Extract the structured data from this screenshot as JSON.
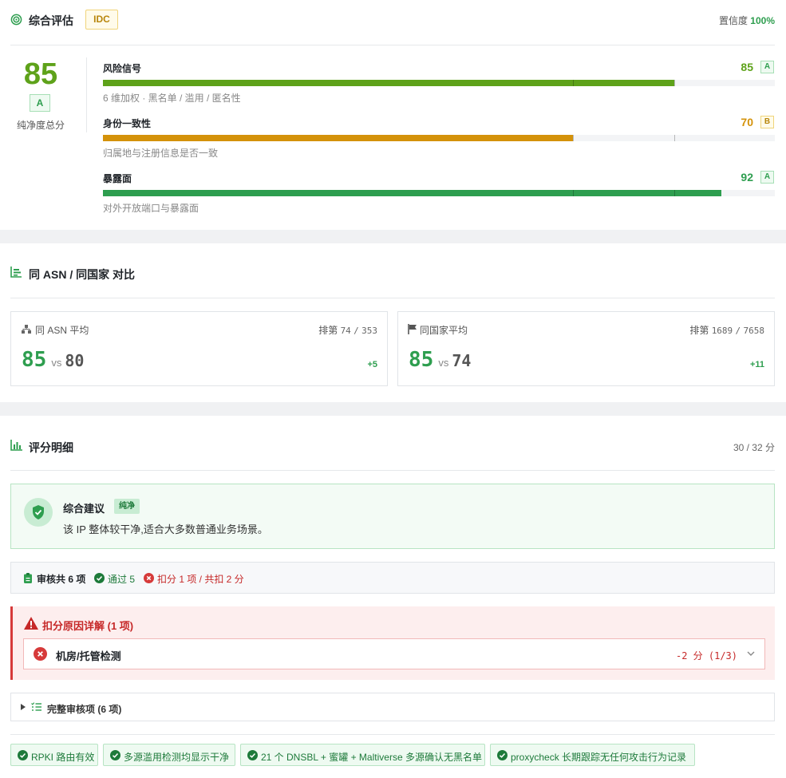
{
  "overview": {
    "title": "综合评估",
    "tag": "IDC",
    "confidence_label": "置信度",
    "confidence_value": "100%",
    "score": "85",
    "grade": "A",
    "score_label": "纯净度总分",
    "metrics": [
      {
        "name": "风险信号",
        "value": "85",
        "grade": "A",
        "desc": "6 维加权 · 黑名单 / 滥用 / 匿名性",
        "fill": 0.85,
        "color": "#5ea21a"
      },
      {
        "name": "身份一致性",
        "value": "70",
        "grade": "B",
        "desc": "归属地与注册信息是否一致",
        "fill": 0.7,
        "color": "#d4920a"
      },
      {
        "name": "暴露面",
        "value": "92",
        "grade": "A",
        "desc": "对外开放端口与暴露面",
        "fill": 0.92,
        "color": "#2e9e4f"
      }
    ]
  },
  "compare": {
    "title": "同 ASN / 同国家 对比",
    "cards": [
      {
        "label": "同 ASN 平均",
        "rank_label": "排第",
        "rank": "74",
        "sep": "/",
        "total": "353",
        "score": "85",
        "vs": "vs",
        "avg": "80",
        "delta": "+5"
      },
      {
        "label": "同国家平均",
        "rank_label": "排第",
        "rank": "1689",
        "sep": "/",
        "total": "7658",
        "score": "85",
        "vs": "vs",
        "avg": "74",
        "delta": "+11"
      }
    ]
  },
  "detail": {
    "title": "评分明细",
    "points": "30 / 32 分",
    "advice_title": "综合建议",
    "advice_badge": "纯净",
    "advice_text": "该 IP 整体较干净,适合大多数普通业务场景。",
    "summary_total": "审核共 6 项",
    "summary_pass": "通过 5",
    "summary_deduct": "扣分 1 项 / 共扣 2 分",
    "deduct_title": "扣分原因详解 (1 项)",
    "deduct_item_name": "机房/托管检测",
    "deduct_item_points": "-2 分 (1/3)",
    "full_audit": "完整审核项 (6 项)",
    "pills": [
      "RPKI 路由有效",
      "多源滥用检测均显示干净",
      "21 个 DNSBL + 蜜罐 + Maltiverse 多源确认无黑名单",
      "proxycheck 长期跟踪无任何攻击行为记录"
    ]
  },
  "colors": {
    "accent": "#2e9e4f",
    "warning": "#d4920a",
    "danger": "#c62828"
  }
}
